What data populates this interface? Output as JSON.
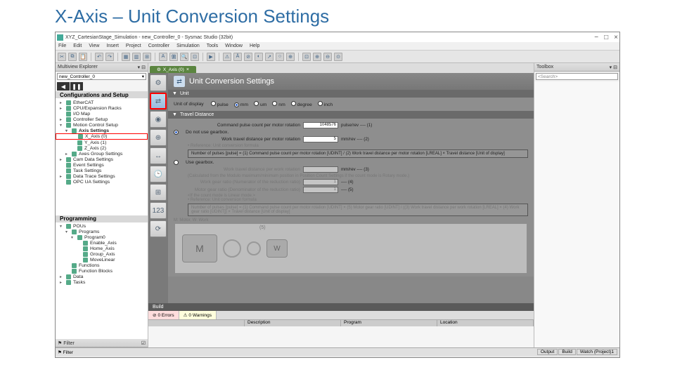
{
  "slide_title": "X-Axis – Unit Conversion Settings",
  "titlebar": {
    "title": "XYZ_CartesianStage_Simulation - new_Controller_0 - Sysmac Studio (32bit)",
    "min": "−",
    "max": "□",
    "close": "×"
  },
  "menubar": [
    "File",
    "Edit",
    "View",
    "Insert",
    "Project",
    "Controller",
    "Simulation",
    "Tools",
    "Window",
    "Help"
  ],
  "left": {
    "panel_title": "Multiview Explorer",
    "controller": "new_Controller_0",
    "section1": "Configurations and Setup",
    "tree1": [
      {
        "l": 0,
        "exp": "▸",
        "label": "EtherCAT"
      },
      {
        "l": 0,
        "exp": "▸",
        "label": "CPU/Expansion Racks"
      },
      {
        "l": 0,
        "exp": "",
        "label": "I/O Map"
      },
      {
        "l": 0,
        "exp": "▸",
        "label": "Controller Setup"
      },
      {
        "l": 0,
        "exp": "▾",
        "label": "Motion Control Setup"
      },
      {
        "l": 1,
        "exp": "▾",
        "label": "Axis Settings",
        "bold": true
      },
      {
        "l": 2,
        "exp": "",
        "label": "X_Axis (0)",
        "sel": true
      },
      {
        "l": 2,
        "exp": "",
        "label": "Y_Axis (1)"
      },
      {
        "l": 2,
        "exp": "",
        "label": "Z_Axis (2)"
      },
      {
        "l": 1,
        "exp": "▸",
        "label": "Axes Group Settings"
      },
      {
        "l": 0,
        "exp": "▸",
        "label": "Cam Data Settings"
      },
      {
        "l": 0,
        "exp": "",
        "label": "Event Settings"
      },
      {
        "l": 0,
        "exp": "",
        "label": "Task Settings"
      },
      {
        "l": 0,
        "exp": "▸",
        "label": "Data Trace Settings"
      },
      {
        "l": 0,
        "exp": "",
        "label": "OPC UA Settings"
      }
    ],
    "section2": "Programming",
    "tree2": [
      {
        "l": 0,
        "exp": "▾",
        "label": "POUs"
      },
      {
        "l": 1,
        "exp": "▾",
        "label": "Programs"
      },
      {
        "l": 2,
        "exp": "▾",
        "label": "Program0"
      },
      {
        "l": 3,
        "exp": "",
        "label": "Enable_Axis"
      },
      {
        "l": 3,
        "exp": "",
        "label": "Home_Axis"
      },
      {
        "l": 3,
        "exp": "",
        "label": "Group_Axis"
      },
      {
        "l": 3,
        "exp": "",
        "label": "MoveLinear"
      },
      {
        "l": 1,
        "exp": "",
        "label": "Functions"
      },
      {
        "l": 1,
        "exp": "",
        "label": "Function Blocks"
      },
      {
        "l": 0,
        "exp": "▸",
        "label": "Data"
      },
      {
        "l": 0,
        "exp": "▸",
        "label": "Tasks"
      }
    ],
    "filter": "Filter"
  },
  "center": {
    "tab_label": "X_Axis (0)",
    "heading": "Unit Conversion Settings",
    "unit_section": "Unit",
    "unit_label": "Unit of display",
    "unit_options": [
      "pulse",
      "mm",
      "um",
      "nm",
      "degree",
      "inch"
    ],
    "unit_selected": 1,
    "travel_section": "Travel Distance",
    "cmd_pulse_label": "Command pulse count per motor rotation",
    "cmd_pulse_val": "1048576",
    "cmd_pulse_unit": "pulse/rev ---- (1)",
    "rb_no_gearbox": "Do not use gearbox.",
    "work_travel_label": "Work travel distance per motor rotation",
    "work_travel_val": "5",
    "work_travel_unit": "mm/rev ---- (2)",
    "ref_formula": "• Reference: Unit conversion formula",
    "formula1": "Number of pulses [pulse] = (1) Command pulse count per motor rotation [UDINT] / (2) Work travel distance per motor rotation [LREAL] × Travel distance [Unit of display]",
    "rb_gearbox": "Use gearbox.",
    "work_rot_label": "Work travel distance per work rotation",
    "work_rot_unit": "mm/rev ---- (3)",
    "calc_note": "(Calculated from the Modulo maximum/minimum position in Position Count Settings if the count mode is Rotary mode.)",
    "gear_num_label": "Work gear ratio (Numerator of the reduction ratio)",
    "gear_num_val": "1",
    "gear_num_unit": "---- (4)",
    "gear_den_label": "Motor gear ratio (Denominator of the reduction ratio)",
    "gear_den_val": "1",
    "gear_den_unit": "---- (5)",
    "linear_note": "<If the count mode is Linear mode.>",
    "ref_formula2": "• Reference: Unit conversion formula",
    "formula2": "Number of pulses [pulse] = (1) Command pulse count per motor rotation [UDINT] × (5) Motor gear ratio [UDINT] / ((3) Work travel distance per work rotation [LREAL] × (4) Work gear ratio [UDINT]) × Travel distance [Unit of display]",
    "legend": "M: Motor, W: Work",
    "build": "Build",
    "btabs": {
      "err": "0 Errors",
      "warn": "0 Warnings"
    },
    "bcols": [
      "",
      "Description",
      "Program",
      "Location"
    ]
  },
  "right": {
    "panel_title": "Toolbox",
    "search_ph": "<Search>"
  },
  "status": {
    "filter": "Filter",
    "tabs": [
      "Output",
      "Build",
      "Watch (Project)1"
    ]
  }
}
